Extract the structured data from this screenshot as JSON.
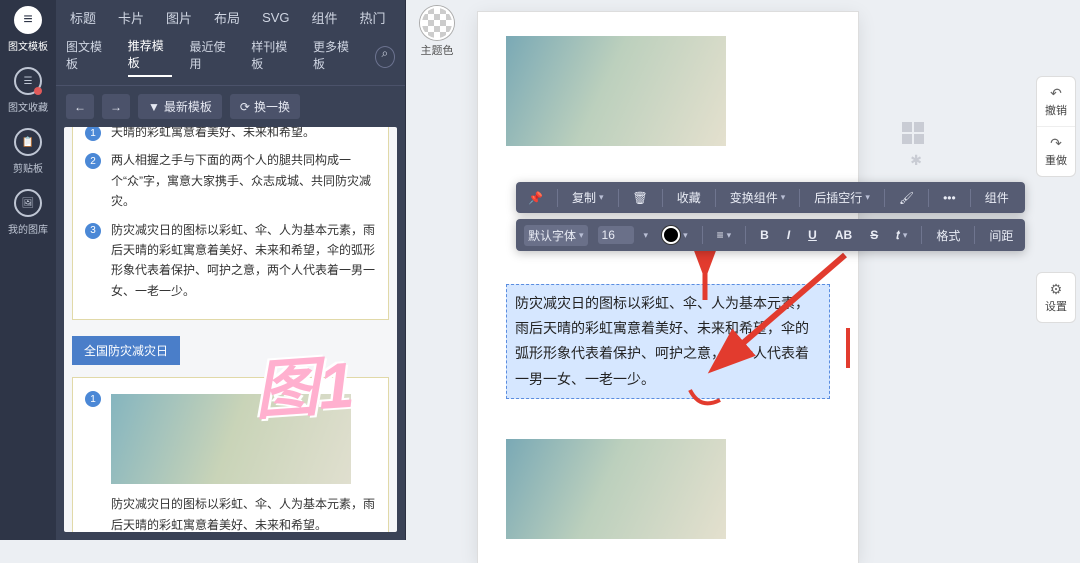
{
  "rail": {
    "items": [
      {
        "label": "图文模板",
        "icon": "≡"
      },
      {
        "label": "图文收藏",
        "icon": "☰"
      },
      {
        "label": "剪贴板",
        "icon": "📋"
      },
      {
        "label": "我的图库",
        "icon": "🖼"
      }
    ]
  },
  "topnav": [
    "标题",
    "卡片",
    "图片",
    "布局",
    "SVG",
    "组件",
    "热门"
  ],
  "tabs": {
    "items": [
      "图文模板",
      "推荐模板",
      "最近使用",
      "样刊模板",
      "更多模板"
    ],
    "active": 1
  },
  "tools": {
    "latest": "最新模板",
    "swap": "换一换"
  },
  "template": {
    "rows": [
      {
        "n": "1",
        "text": "天晴的彩虹寓意着美好、未来和希望。"
      },
      {
        "n": "2",
        "text": "两人相握之手与下面的两个人的腿共同构成一个“众”字，寓意大家携手、众志成城、共同防灾减灾。"
      },
      {
        "n": "3",
        "text": "防灾减灾日的图标以彩虹、伞、人为基本元素，雨后天晴的彩虹寓意着美好、未来和希望，伞的弧形形象代表着保护、呵护之意，两个人代表着一男一女、一老一少。"
      }
    ],
    "tag": "全国防灾减灾日",
    "row4": {
      "n": "1",
      "text": "防灾减灾日的图标以彩虹、伞、人为基本元素，雨后天晴的彩虹寓意着美好、未来和希望。"
    }
  },
  "stamp": "图1",
  "theme_label": "主题色",
  "editor_text": "防灾减灾日的图标以彩虹、伞、人为基本元素，雨后天晴的彩虹寓意着美好、未来和希望，伞的弧形形象代表着保护、呵护之意，两个人代表着一男一女、一老一少。",
  "toolbar1": {
    "copy": "复制",
    "trash": "🗑",
    "favorite": "收藏",
    "transform": "变换组件",
    "insert": "后插空行",
    "comp": "组件"
  },
  "toolbar2": {
    "font": "默认字体",
    "size": "16",
    "align": "≡",
    "bold": "B",
    "italic": "I",
    "underline": "U",
    "ab": "AB",
    "strike": "S",
    "tt": "𝑡",
    "format": "格式",
    "spacing": "间距"
  },
  "rrail": {
    "undo": "撤销",
    "redo": "重做",
    "settings": "设置"
  },
  "icons": {
    "pin": "📌",
    "more": "•••",
    "paint": "🖌",
    "refresh": "⟳",
    "back": "←",
    "fwd": "→",
    "filter": "▼",
    "search": "⌕",
    "caret": "▾",
    "undo": "↶",
    "redo": "↷",
    "gear": "⚙"
  }
}
